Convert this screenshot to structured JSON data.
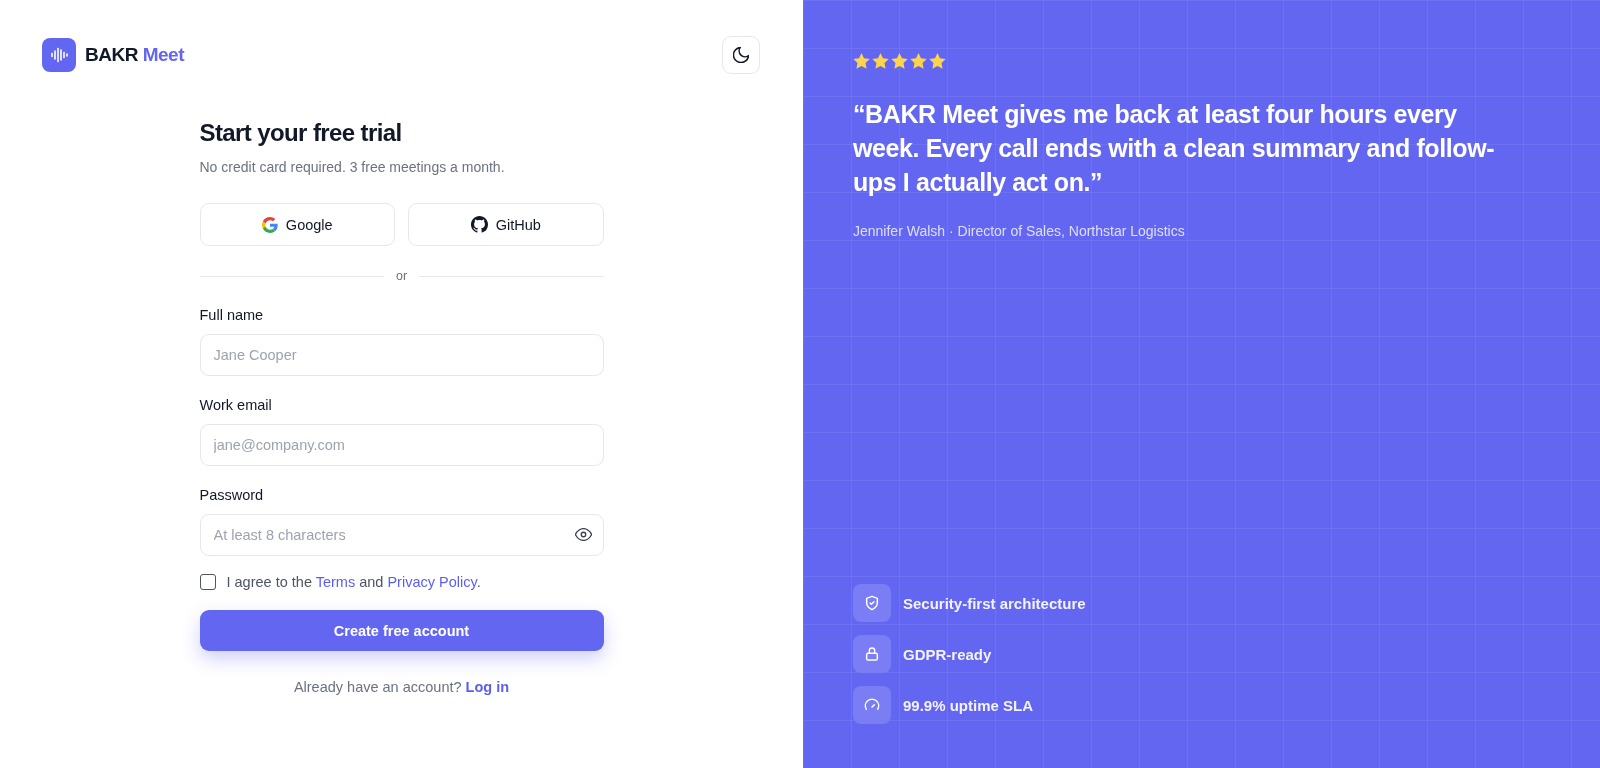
{
  "brand": {
    "name": "BAKR",
    "accent": "Meet"
  },
  "form": {
    "title": "Start your free trial",
    "subtitle": "No credit card required. 3 free meetings a month.",
    "social_buttons": [
      {
        "kind": "google",
        "label": "Google"
      },
      {
        "kind": "github",
        "label": "GitHub"
      }
    ],
    "divider": "or",
    "fields": [
      {
        "kind": "text",
        "label": "Full name",
        "placeholder": "Jane Cooper"
      },
      {
        "kind": "email",
        "label": "Work email",
        "placeholder": "jane@company.com"
      },
      {
        "kind": "password",
        "label": "Password",
        "placeholder": "At least 8 characters"
      }
    ],
    "agreement": {
      "checked": false,
      "parts": [
        {
          "kind": "text",
          "text": "I agree to the "
        },
        {
          "kind": "link",
          "text": "Terms"
        },
        {
          "kind": "text",
          "text": " and "
        },
        {
          "kind": "link",
          "text": "Privacy Policy"
        },
        {
          "kind": "text",
          "text": "."
        }
      ]
    },
    "submit": "Create free account",
    "login_prompt": {
      "text": "Already have an account?",
      "link": "Log in"
    }
  },
  "testimonial": {
    "stars": 5,
    "quote": "“BAKR Meet gives me back at least four hours every week. Every call ends with a clean summary and follow-ups I actually act on.”",
    "attribution": "Jennifer Walsh · Director of Sales, Northstar Logistics"
  },
  "features": [
    {
      "kind": "shield",
      "label": "Security-first architecture"
    },
    {
      "kind": "lock",
      "label": "GDPR-ready"
    },
    {
      "kind": "gauge",
      "label": "99.9% uptime SLA"
    }
  ]
}
